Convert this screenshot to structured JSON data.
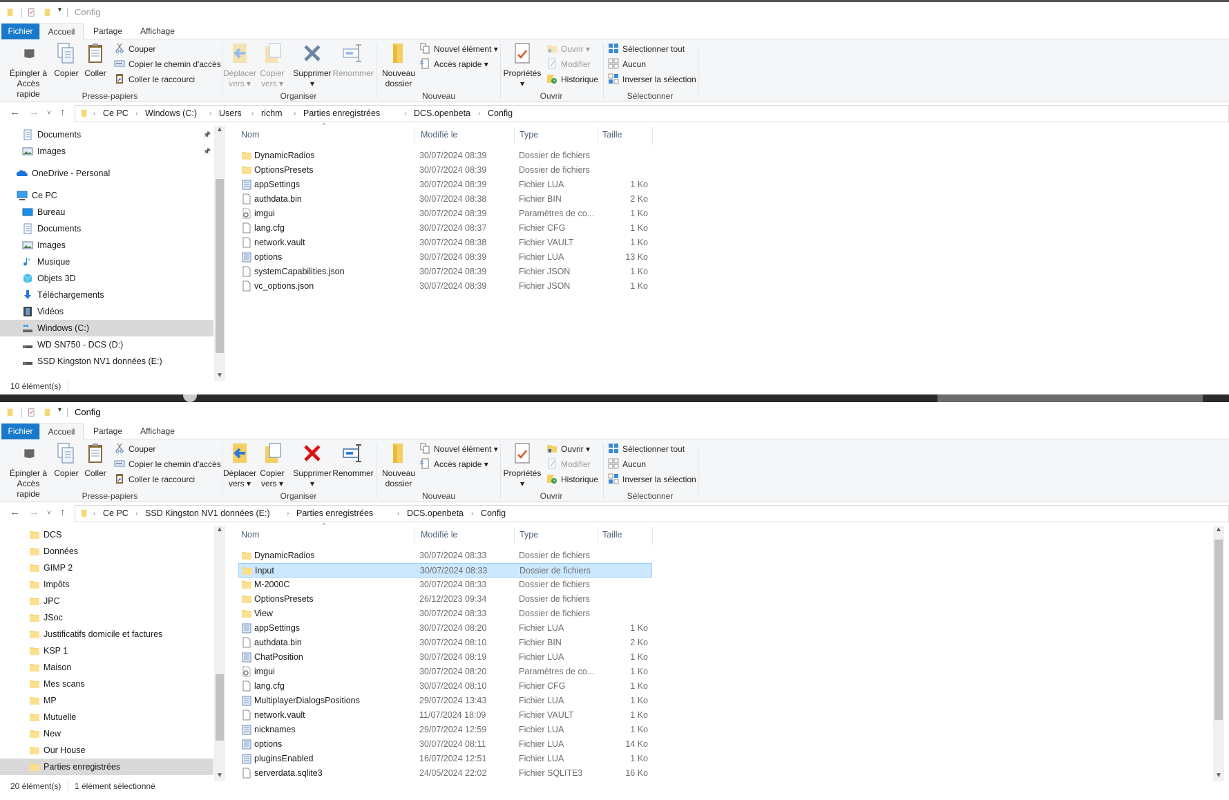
{
  "tabs": {
    "file": "Fichier",
    "home": "Accueil",
    "share": "Partage",
    "view": "Affichage"
  },
  "ribbon": {
    "pin": "Épingler à\nAccès rapide",
    "copy": "Copier",
    "paste": "Coller",
    "cut": "Couper",
    "copy_path": "Copier le chemin d'accès",
    "paste_shortcut": "Coller le raccourci",
    "move_to": "Déplacer\nvers ▾",
    "copy_to": "Copier\nvers ▾",
    "delete": "Supprimer\n▾",
    "rename": "Renommer",
    "new_folder": "Nouveau\ndossier",
    "new_item": "Nouvel élément ▾",
    "easy_access": "Accès rapide ▾",
    "properties": "Propriétés\n▾",
    "open": "Ouvrir ▾",
    "edit": "Modifier",
    "history": "Historique",
    "select_all": "Sélectionner tout",
    "select_none": "Aucun",
    "invert_selection": "Inverser la sélection",
    "groups": {
      "clipboard": "Presse-papiers",
      "organize": "Organiser",
      "new": "Nouveau",
      "open": "Ouvrir",
      "select": "Sélectionner"
    }
  },
  "columns": {
    "name": "Nom",
    "modified": "Modifié le",
    "type": "Type",
    "size": "Taille"
  },
  "windows": [
    {
      "title": "Config",
      "active": false,
      "disabled": [
        "move_to",
        "copy_to",
        "rename",
        "open",
        "edit"
      ],
      "crumbs": [
        "Ce PC",
        "Windows (C:)",
        "Users",
        "richm",
        "Parties enregistrées",
        "DCS.openbeta",
        "Config"
      ],
      "nav": [
        {
          "label": "Documents",
          "icon": "documents",
          "level": 2,
          "pinned": true
        },
        {
          "label": "Images",
          "icon": "images",
          "level": 2,
          "pinned": true
        },
        {
          "label": "OneDrive - Personal",
          "icon": "onedrive",
          "level": 1,
          "gap": true
        },
        {
          "label": "Ce PC",
          "icon": "pc",
          "level": 1,
          "gap": true
        },
        {
          "label": "Bureau",
          "icon": "desktop",
          "level": 2
        },
        {
          "label": "Documents",
          "icon": "documents",
          "level": 2
        },
        {
          "label": "Images",
          "icon": "images",
          "level": 2
        },
        {
          "label": "Musique",
          "icon": "music",
          "level": 2
        },
        {
          "label": "Objets 3D",
          "icon": "objects3d",
          "level": 2
        },
        {
          "label": "Téléchargements",
          "icon": "download",
          "level": 2
        },
        {
          "label": "Vidéos",
          "icon": "video",
          "level": 2
        },
        {
          "label": "Windows (C:)",
          "icon": "drive-windows",
          "level": 2,
          "selected": true
        },
        {
          "label": "WD SN750 - DCS (D:)",
          "icon": "drive",
          "level": 2
        },
        {
          "label": "SSD Kingston NV1 données (E:)",
          "icon": "drive",
          "level": 2
        }
      ],
      "files": [
        {
          "name": "DynamicRadios",
          "modified": "30/07/2024 08:39",
          "type": "Dossier de fichiers",
          "size": "",
          "icon": "folder"
        },
        {
          "name": "OptionsPresets",
          "modified": "30/07/2024 08:39",
          "type": "Dossier de fichiers",
          "size": "",
          "icon": "folder"
        },
        {
          "name": "appSettings",
          "modified": "30/07/2024 08:39",
          "type": "Fichier LUA",
          "size": "1 Ko",
          "icon": "lua"
        },
        {
          "name": "authdata.bin",
          "modified": "30/07/2024 08:38",
          "type": "Fichier BIN",
          "size": "2 Ko",
          "icon": "file"
        },
        {
          "name": "imgui",
          "modified": "30/07/2024 08:39",
          "type": "Paramètres de co...",
          "size": "1 Ko",
          "icon": "settings"
        },
        {
          "name": "lang.cfg",
          "modified": "30/07/2024 08:37",
          "type": "Fichier CFG",
          "size": "1 Ko",
          "icon": "file"
        },
        {
          "name": "network.vault",
          "modified": "30/07/2024 08:38",
          "type": "Fichier VAULT",
          "size": "1 Ko",
          "icon": "file"
        },
        {
          "name": "options",
          "modified": "30/07/2024 08:39",
          "type": "Fichier LUA",
          "size": "13 Ko",
          "icon": "lua"
        },
        {
          "name": "systemCapabilities.json",
          "modified": "30/07/2024 08:39",
          "type": "Fichier JSON",
          "size": "1 Ko",
          "icon": "file"
        },
        {
          "name": "vc_options.json",
          "modified": "30/07/2024 08:39",
          "type": "Fichier JSON",
          "size": "1 Ko",
          "icon": "file"
        }
      ],
      "status": {
        "count": "10 élément(s)",
        "selected": ""
      }
    },
    {
      "title": "Config",
      "active": true,
      "disabled": [
        "edit"
      ],
      "crumbs": [
        "Ce PC",
        "SSD Kingston NV1 données (E:)",
        "Parties enregistrées",
        "DCS.openbeta",
        "Config"
      ],
      "nav": [
        {
          "label": "DCS",
          "icon": "folder",
          "level": 3
        },
        {
          "label": "Données",
          "icon": "folder",
          "level": 3
        },
        {
          "label": "GIMP 2",
          "icon": "folder",
          "level": 3
        },
        {
          "label": "Impôts",
          "icon": "folder",
          "level": 3
        },
        {
          "label": "JPC",
          "icon": "folder",
          "level": 3
        },
        {
          "label": "JSoc",
          "icon": "folder",
          "level": 3
        },
        {
          "label": "Justificatifs domicile et factures",
          "icon": "folder",
          "level": 3
        },
        {
          "label": "KSP 1",
          "icon": "folder",
          "level": 3
        },
        {
          "label": "Maison",
          "icon": "folder",
          "level": 3
        },
        {
          "label": "Mes scans",
          "icon": "folder",
          "level": 3
        },
        {
          "label": "MP",
          "icon": "folder",
          "level": 3
        },
        {
          "label": "Mutuelle",
          "icon": "folder",
          "level": 3
        },
        {
          "label": "New",
          "icon": "folder",
          "level": 3
        },
        {
          "label": "Our House",
          "icon": "folder",
          "level": 3
        },
        {
          "label": "Parties enregistrées",
          "icon": "folder",
          "level": 3,
          "selected": true
        }
      ],
      "files": [
        {
          "name": "DynamicRadios",
          "modified": "30/07/2024 08:33",
          "type": "Dossier de fichiers",
          "size": "",
          "icon": "folder"
        },
        {
          "name": "Input",
          "modified": "30/07/2024 08:33",
          "type": "Dossier de fichiers",
          "size": "",
          "icon": "folder",
          "selected": true
        },
        {
          "name": "M-2000C",
          "modified": "30/07/2024 08:33",
          "type": "Dossier de fichiers",
          "size": "",
          "icon": "folder"
        },
        {
          "name": "OptionsPresets",
          "modified": "26/12/2023 09:34",
          "type": "Dossier de fichiers",
          "size": "",
          "icon": "folder"
        },
        {
          "name": "View",
          "modified": "30/07/2024 08:33",
          "type": "Dossier de fichiers",
          "size": "",
          "icon": "folder"
        },
        {
          "name": "appSettings",
          "modified": "30/07/2024 08:20",
          "type": "Fichier LUA",
          "size": "1 Ko",
          "icon": "lua"
        },
        {
          "name": "authdata.bin",
          "modified": "30/07/2024 08:10",
          "type": "Fichier BIN",
          "size": "2 Ko",
          "icon": "file"
        },
        {
          "name": "ChatPosition",
          "modified": "30/07/2024 08:19",
          "type": "Fichier LUA",
          "size": "1 Ko",
          "icon": "lua"
        },
        {
          "name": "imgui",
          "modified": "30/07/2024 08:20",
          "type": "Paramètres de co...",
          "size": "1 Ko",
          "icon": "settings"
        },
        {
          "name": "lang.cfg",
          "modified": "30/07/2024 08:10",
          "type": "Fichier CFG",
          "size": "1 Ko",
          "icon": "file"
        },
        {
          "name": "MultiplayerDialogsPositions",
          "modified": "29/07/2024 13:43",
          "type": "Fichier LUA",
          "size": "1 Ko",
          "icon": "lua"
        },
        {
          "name": "network.vault",
          "modified": "11/07/2024 18:09",
          "type": "Fichier VAULT",
          "size": "1 Ko",
          "icon": "file"
        },
        {
          "name": "nicknames",
          "modified": "29/07/2024 12:59",
          "type": "Fichier LUA",
          "size": "1 Ko",
          "icon": "lua"
        },
        {
          "name": "options",
          "modified": "30/07/2024 08:11",
          "type": "Fichier LUA",
          "size": "14 Ko",
          "icon": "lua"
        },
        {
          "name": "pluginsEnabled",
          "modified": "16/07/2024 12:51",
          "type": "Fichier LUA",
          "size": "1 Ko",
          "icon": "lua"
        },
        {
          "name": "serverdata.sqlite3",
          "modified": "24/05/2024 22:02",
          "type": "Fichier SQLITE3",
          "size": "16 Ko",
          "icon": "file"
        }
      ],
      "status": {
        "count": "20 élément(s)",
        "selected": "1 élément sélectionné"
      }
    }
  ],
  "colors": {
    "accent": "#1979ca",
    "selection": "#cce8ff",
    "selection_border": "#99d1ff",
    "folder": "#f8d775"
  }
}
